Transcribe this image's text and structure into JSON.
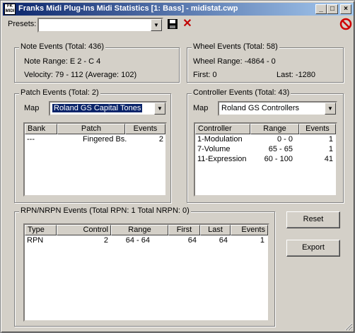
{
  "window": {
    "title": "Franks Midi Plug-Ins Midi Statistics [1: Bass] - midistat.cwp",
    "app_icon_text": "FK MIDI"
  },
  "toolbar": {
    "presets_label": "Presets:",
    "presets_value": ""
  },
  "note_events": {
    "title": "Note Events (Total: 436)",
    "range": "Note Range: E 2 - C 4",
    "velocity": "Velocity: 79 - 112 (Average: 102)"
  },
  "wheel_events": {
    "title": "Wheel Events (Total: 58)",
    "range": "Wheel Range: -4864 - 0",
    "first": "First: 0",
    "last": "Last: -1280"
  },
  "patch_events": {
    "title": "Patch Events (Total: 2)",
    "map_label": "Map",
    "map_value": "Roland GS Capital Tones",
    "columns": [
      "Bank",
      "Patch",
      "Events"
    ],
    "rows": [
      [
        "---",
        "Fingered Bs.",
        "2"
      ]
    ]
  },
  "controller_events": {
    "title": "Controller Events (Total: 43)",
    "map_label": "Map",
    "map_value": "Roland GS Controllers",
    "columns": [
      "Controller",
      "Range",
      "Events"
    ],
    "rows": [
      [
        "1-Modulation",
        "0 - 0",
        "1"
      ],
      [
        "7-Volume",
        "65 - 65",
        "1"
      ],
      [
        "11-Expression",
        "60 - 100",
        "41"
      ]
    ]
  },
  "rpn_events": {
    "title": "RPN/NRPN Events (Total RPN: 1  Total NRPN: 0)",
    "columns": [
      "Type",
      "Control",
      "Range",
      "First",
      "Last",
      "Events"
    ],
    "rows": [
      [
        "RPN",
        "2",
        "64 - 64",
        "64",
        "64",
        "1"
      ]
    ]
  },
  "buttons": {
    "reset": "Reset",
    "export": "Export"
  }
}
